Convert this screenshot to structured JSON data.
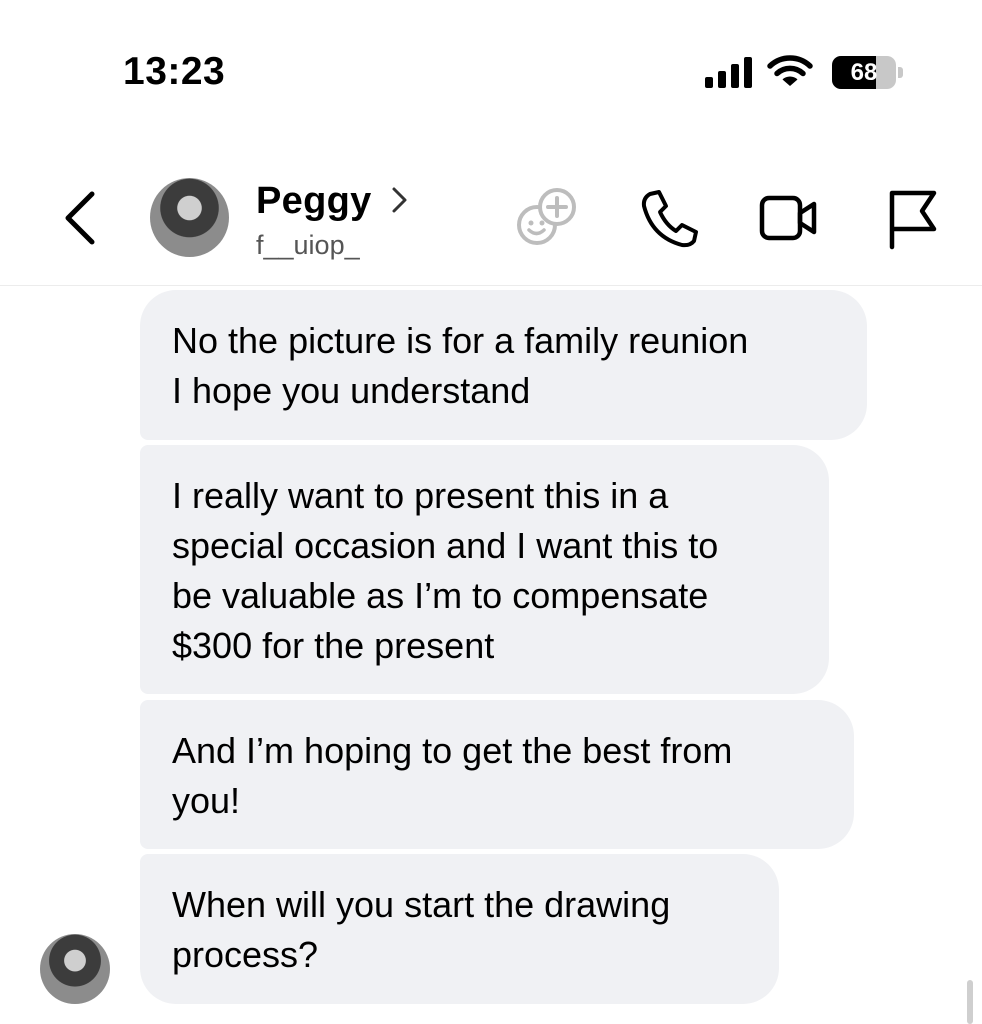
{
  "status_bar": {
    "time": "13:23",
    "signal_icon": "cellular-signal-icon",
    "wifi_icon": "wifi-icon",
    "battery_level": "68",
    "battery_fraction": 0.68
  },
  "header": {
    "back_icon": "chevron-left-icon",
    "contact_name": "Peggy",
    "contact_username": "f__uiop_",
    "name_chevron_icon": "chevron-right-icon",
    "action_icons": [
      "stickers-icon",
      "phone-icon",
      "video-camera-icon",
      "flag-icon"
    ]
  },
  "messages": [
    {
      "sender": "contact",
      "text": "No the picture is for a family reunion\nI hope you understand"
    },
    {
      "sender": "contact",
      "text": "I really want to present this in a\nspecial occasion and I want this to\nbe valuable as I’m to compensate\n$300 for the present"
    },
    {
      "sender": "contact",
      "text": "And I’m hoping to get the best from\nyou!"
    },
    {
      "sender": "contact",
      "text": "When will you start the drawing\nprocess?"
    }
  ],
  "colors": {
    "bubble_background": "#f0f1f4",
    "text": "#000000",
    "secondary_text": "#555555"
  }
}
